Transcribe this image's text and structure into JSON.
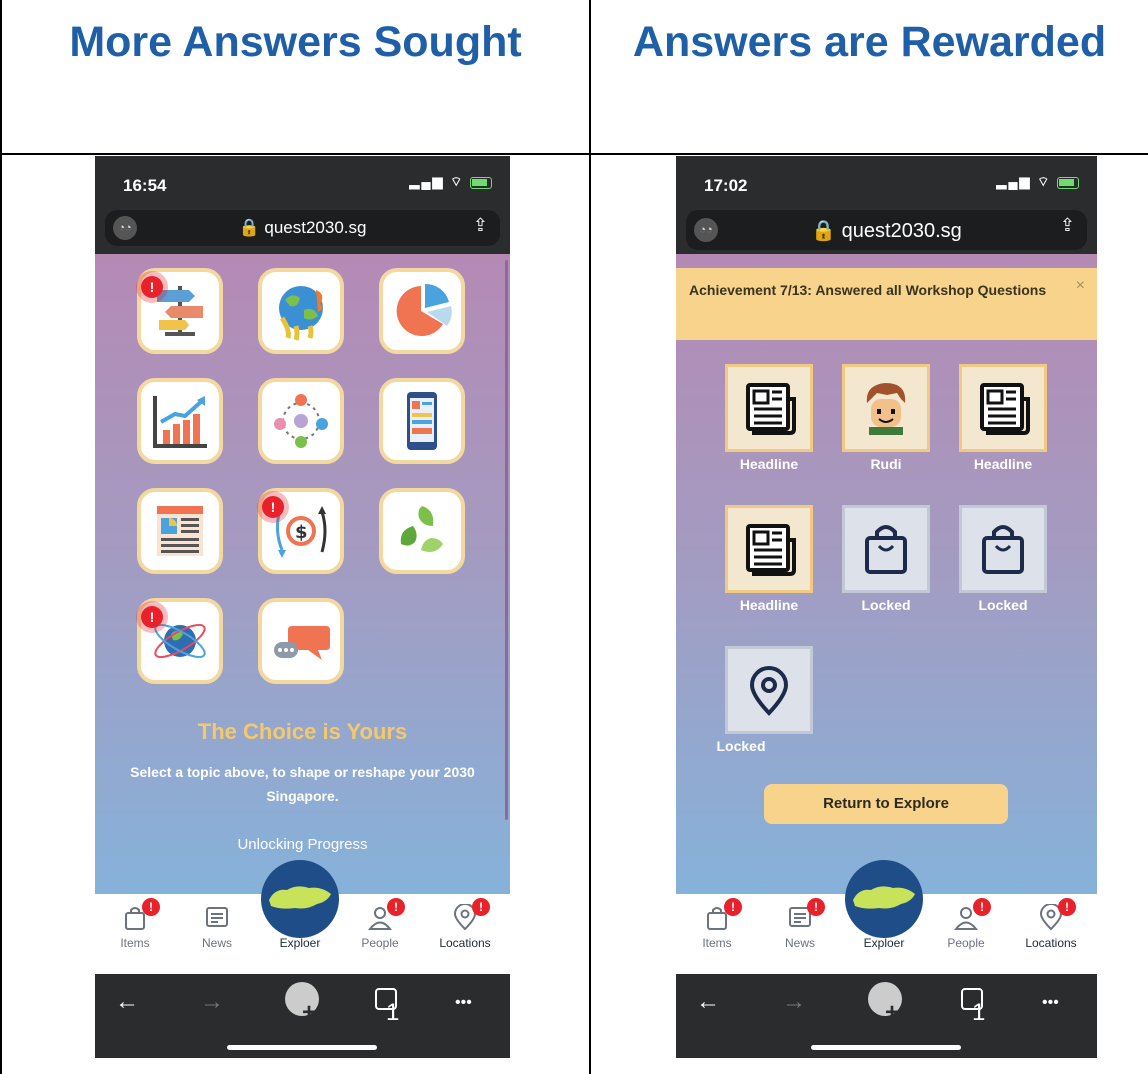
{
  "headers": {
    "left": "More Answers Sought",
    "right": "Answers are Rewarded"
  },
  "left_phone": {
    "time": "16:54",
    "url": "quest2030.sg",
    "topics": [
      {
        "icon": "signpost-icon",
        "badge": "!"
      },
      {
        "icon": "melting-earth-icon",
        "badge": ""
      },
      {
        "icon": "pie-chart-icon",
        "badge": ""
      },
      {
        "icon": "growth-chart-icon",
        "badge": ""
      },
      {
        "icon": "people-network-icon",
        "badge": ""
      },
      {
        "icon": "mobile-app-icon",
        "badge": ""
      },
      {
        "icon": "newspaper-icon",
        "badge": ""
      },
      {
        "icon": "money-flow-icon",
        "badge": "!"
      },
      {
        "icon": "recycle-leaves-icon",
        "badge": ""
      },
      {
        "icon": "globe-orbit-icon",
        "badge": "!"
      },
      {
        "icon": "chat-bubbles-icon",
        "badge": ""
      }
    ],
    "choice_title": "The Choice is Yours",
    "choice_subtitle": "Select a topic above, to shape or reshape your 2030 Singapore.",
    "progress_label": "Unlocking Progress"
  },
  "right_phone": {
    "time": "17:02",
    "url": "quest2030.sg",
    "banner_text": "Achievement 7/13: Answered all Workshop Questions",
    "banner_close": "×",
    "rewards": [
      {
        "label": "Headline",
        "icon": "newspaper-icon",
        "locked": false
      },
      {
        "label": "Rudi",
        "icon": "character-avatar-icon",
        "locked": false
      },
      {
        "label": "Headline",
        "icon": "newspaper-icon",
        "locked": false
      },
      {
        "label": "Headline",
        "icon": "newspaper-icon",
        "locked": false
      },
      {
        "label": "Locked",
        "icon": "shopping-bag-icon",
        "locked": true
      },
      {
        "label": "Locked",
        "icon": "shopping-bag-icon",
        "locked": true
      },
      {
        "label": "Locked",
        "icon": "location-pin-icon",
        "locked": true
      }
    ],
    "return_button": "Return to Explore"
  },
  "tabs": {
    "items": "Items",
    "news": "News",
    "explorer": "Exploer",
    "people": "People",
    "locations": "Locations",
    "badge": "!"
  },
  "browser": {
    "back": "←",
    "forward": "→",
    "new_tab": "+",
    "tab_count": "1",
    "more": "•••"
  }
}
